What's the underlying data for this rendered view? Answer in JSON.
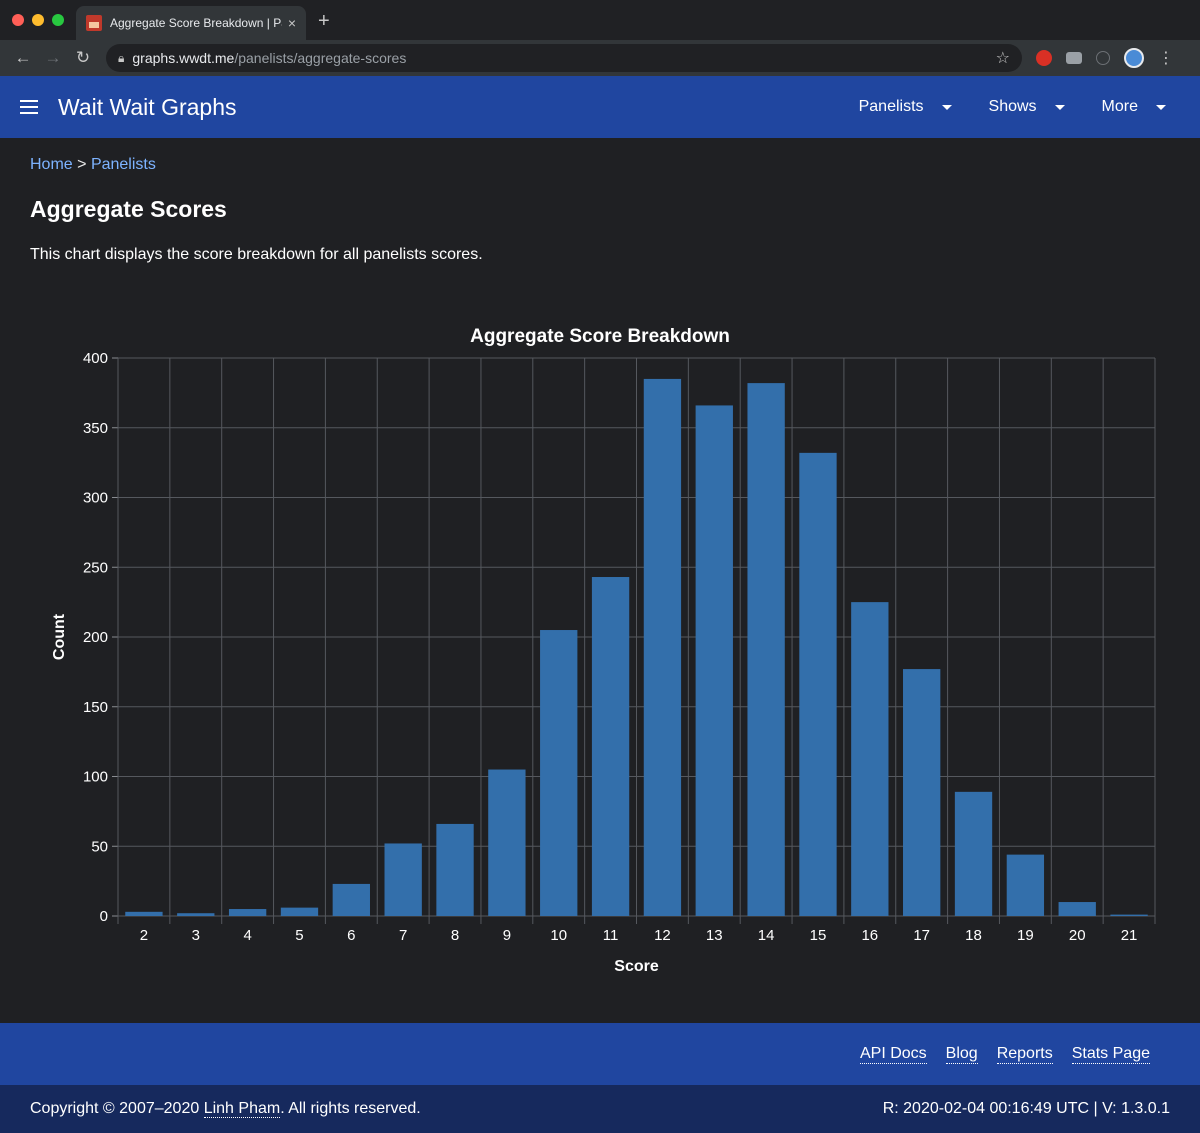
{
  "browser": {
    "tab_title": "Aggregate Score Breakdown | Pa",
    "url_host": "graphs.wwdt.me",
    "url_path": "/panelists/aggregate-scores",
    "new_tab": "+",
    "close": "×"
  },
  "navbar": {
    "brand": "Wait Wait Graphs",
    "menus": [
      "Panelists",
      "Shows",
      "More"
    ]
  },
  "breadcrumb": {
    "home": "Home",
    "separator": ">",
    "current": "Panelists"
  },
  "page": {
    "title": "Aggregate Scores",
    "description": "This chart displays the score breakdown for all panelists scores."
  },
  "chart_data": {
    "type": "bar",
    "title": "Aggregate Score Breakdown",
    "xlabel": "Score",
    "ylabel": "Count",
    "categories": [
      "2",
      "3",
      "4",
      "5",
      "6",
      "7",
      "8",
      "9",
      "10",
      "11",
      "12",
      "13",
      "14",
      "15",
      "16",
      "17",
      "18",
      "19",
      "20",
      "21"
    ],
    "values": [
      3,
      2,
      5,
      6,
      23,
      52,
      66,
      105,
      205,
      243,
      385,
      366,
      382,
      332,
      225,
      177,
      89,
      44,
      10,
      1
    ],
    "ylim": [
      0,
      400
    ],
    "yticks": [
      0,
      50,
      100,
      150,
      200,
      250,
      300,
      350,
      400
    ],
    "grid": true,
    "bar_color": "#336fab"
  },
  "footer": {
    "links": [
      "API Docs",
      "Blog",
      "Reports",
      "Stats Page"
    ],
    "copyright_prefix": "Copyright © 2007–2020",
    "author": "Linh Pham",
    "copyright_suffix": ". All rights reserved.",
    "revision": "R: 2020-02-04 00:16:49 UTC | V: 1.3.0.1"
  },
  "colors": {
    "navbar": "#2046a0",
    "footer_bottom": "#16295d",
    "background": "#1f2023",
    "link": "#7db3ff"
  }
}
